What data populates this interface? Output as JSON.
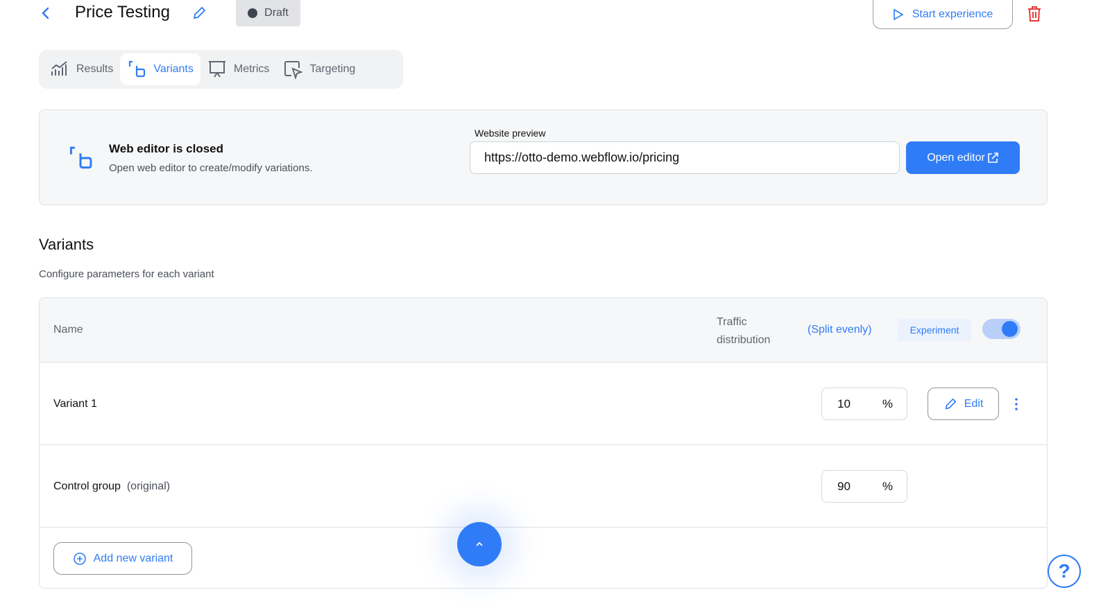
{
  "header": {
    "title": "Price Testing",
    "status": "Draft",
    "start_label": "Start experience"
  },
  "tabs": [
    {
      "label": "Results"
    },
    {
      "label": "Variants"
    },
    {
      "label": "Metrics"
    },
    {
      "label": "Targeting"
    }
  ],
  "editor": {
    "title": "Web editor is closed",
    "subtitle": "Open web editor to create/modify variations.",
    "preview_label": "Website preview",
    "preview_url": "https://otto-demo.webflow.io/pricing",
    "open_label": "Open editor"
  },
  "variants": {
    "title": "Variants",
    "subtitle": "Configure parameters for each variant",
    "columns": {
      "name": "Name",
      "traffic_line1": "Traffic",
      "traffic_line2": "distribution",
      "split": "(Split evenly)",
      "experiment": "Experiment",
      "experiment_enabled": true
    },
    "rows": [
      {
        "name": "Variant 1",
        "suffix": "",
        "traffic": "10",
        "unit": "%",
        "edit_label": "Edit"
      },
      {
        "name": "Control group",
        "suffix": "(original)",
        "traffic": "90",
        "unit": "%"
      }
    ],
    "add_label": "Add new variant"
  },
  "help": {
    "label": "?"
  },
  "colors": {
    "accent": "#2f7cf6"
  }
}
